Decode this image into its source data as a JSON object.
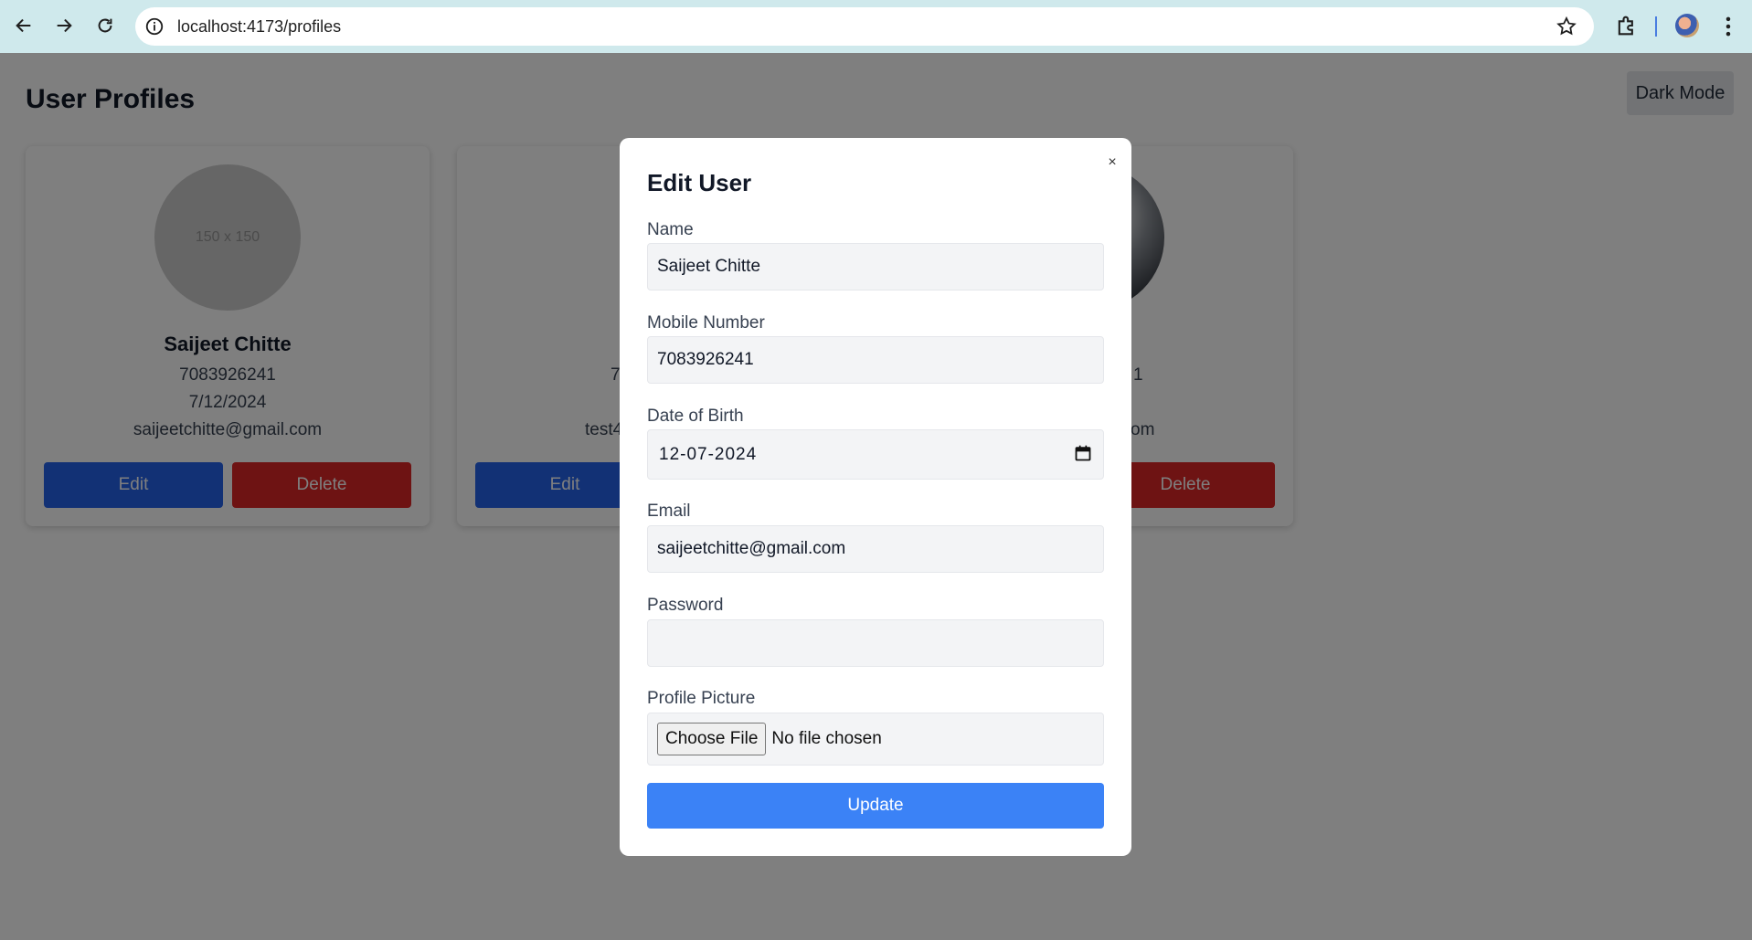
{
  "browser": {
    "url": "localhost:4173/profiles",
    "chrome_color": "#cfe9ec"
  },
  "page": {
    "title": "User Profiles",
    "dark_mode_label": "Dark Mode"
  },
  "cards": [
    {
      "picture_placeholder": "150 x 150",
      "name": "Saijeet Chitte",
      "mobile": "7083926241",
      "dob": "7/12/2024",
      "email": "saijeetchitte@gmail.com",
      "edit_label": "Edit",
      "delete_label": "Delete"
    },
    {
      "mobile_partial": "7",
      "email_partial": "test4",
      "edit_label": "Edit"
    },
    {
      "mobile_partial": "1",
      "email_partial": "om",
      "delete_label": "Delete"
    }
  ],
  "modal": {
    "title": "Edit User",
    "close_glyph": "×",
    "fields": {
      "name_label": "Name",
      "name_value": "Saijeet Chitte",
      "mobile_label": "Mobile Number",
      "mobile_value": "7083926241",
      "dob_label": "Date of Birth",
      "dob_value": "12-07-2024",
      "email_label": "Email",
      "email_value": "saijeetchitte@gmail.com",
      "password_label": "Password",
      "password_value": "",
      "picture_label": "Profile Picture",
      "file_button": "Choose File",
      "file_status": "No file chosen"
    },
    "update_label": "Update"
  },
  "colors": {
    "primary": "#3b82f6",
    "edit": "#2563eb",
    "delete": "#dc2626",
    "overlay": "rgba(0,0,0,0.5)"
  }
}
